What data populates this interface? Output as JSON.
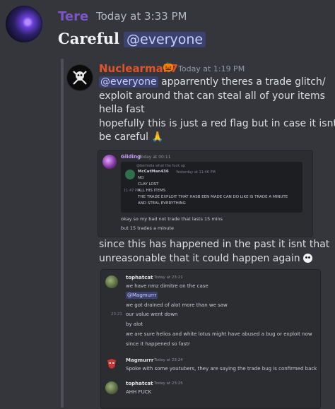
{
  "top_message": {
    "author": "Tere",
    "timestamp": "Today at 3:33 PM",
    "text": "Careful",
    "mention": "@everyone",
    "author_color": "#7a54c9"
  },
  "forwarded_message": {
    "author": "Nuclearman7",
    "badge": "🎃",
    "timestamp": "Today at 1:19 PM",
    "mention": "@everyone",
    "lines": [
      "apparrently theres a trade glitch/",
      "exploit around that can steal all of your items",
      "hella fast",
      "hopefully this is just a red flag but in case it isnt",
      "be careful 🙏"
    ],
    "author_color": "#e0542a"
  },
  "embed_screenshot": {
    "author": "Gliding",
    "timestamp": "Today at 00:11",
    "inner": {
      "reply_preview": "@berlodia what the fuck up",
      "author": "McCatMan436",
      "timestamp": "Yesterday at 11:46 PM",
      "side_time": "11:47 PM",
      "lines": [
        "NO",
        "CLAY LOST",
        "ALL HIS ITEMS",
        "THE TRADE EXPLOIT THAT HASB EEN MADE CAN DO LIKE IS TRADE A MINUTE",
        "AND STEAL EVERYTHING"
      ]
    },
    "captions": [
      "okay so my bad not trade that lasts 15 mins",
      "but 15 trades a minute"
    ]
  },
  "since_text": {
    "line1": "since this has happened in the past it isnt that",
    "line2": "unreasonable that it could happen again",
    "emoji": "skull-icon"
  },
  "embed_chat": {
    "messages": [
      {
        "author": "tophatcat",
        "timestamp": "Today at 23:21",
        "lines": [
          "we have nmz dimitre on the case"
        ],
        "mention": "@Magmurrr"
      },
      {
        "side_time": "",
        "lines": [
          "we got drained of alot more than we saw"
        ]
      },
      {
        "side_time": "23:21",
        "lines": [
          "our value went down",
          "by alot",
          "we are sure helios and white lotus might have abused a bug or exploit now",
          "since it happened so fastr"
        ]
      },
      {
        "author": "Magmurrr",
        "timestamp": "Today at 23:24",
        "lines": [
          "Spoke with some youtubers, they are saying the trade bug is confirmed back"
        ]
      },
      {
        "author": "tophatcat",
        "timestamp": "Today at 23:25",
        "lines": [
          "AHH FUCK"
        ]
      }
    ]
  },
  "colors": {
    "background": "#35363b",
    "mention_bg": "#3c4270",
    "mention_text": "#c9cdfb"
  }
}
